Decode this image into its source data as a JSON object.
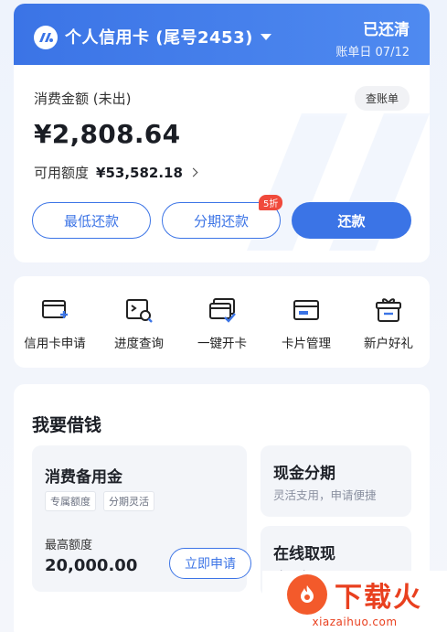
{
  "card": {
    "title": "个人信用卡 (尾号2453)",
    "status": "已还清",
    "bill_date": "账单日 07/12",
    "spend_label": "消费金额 (未出)",
    "view_bill": "查账单",
    "amount": "¥2,808.64",
    "available_label": "可用额度",
    "available_value": "¥53,582.18",
    "buttons": {
      "min_pay": "最低还款",
      "installment": "分期还款",
      "installment_badge": "5折",
      "pay": "还款"
    }
  },
  "actions": [
    {
      "label": "信用卡申请",
      "icon": "card-add-icon"
    },
    {
      "label": "进度查询",
      "icon": "progress-search-icon"
    },
    {
      "label": "一键开卡",
      "icon": "card-activate-icon"
    },
    {
      "label": "卡片管理",
      "icon": "card-manage-icon"
    },
    {
      "label": "新户好礼",
      "icon": "gift-icon"
    }
  ],
  "borrow": {
    "title": "我要借钱",
    "reserve": {
      "title": "消费备用金",
      "tags": [
        "专属额度",
        "分期灵活"
      ],
      "max_label": "最高额度",
      "max_value": "20,000.00",
      "apply": "立即申请"
    },
    "cash_installment": {
      "title": "现金分期",
      "desc": "灵活支用，申请便捷"
    },
    "online_cash": {
      "title": "在线取现",
      "desc": "随取随用"
    }
  },
  "watermark": {
    "name": "下载火",
    "domain": "xiazaihuo.com"
  },
  "colors": {
    "primary": "#3b74e6",
    "badge": "#f04a3c",
    "site": "#e9401f"
  }
}
